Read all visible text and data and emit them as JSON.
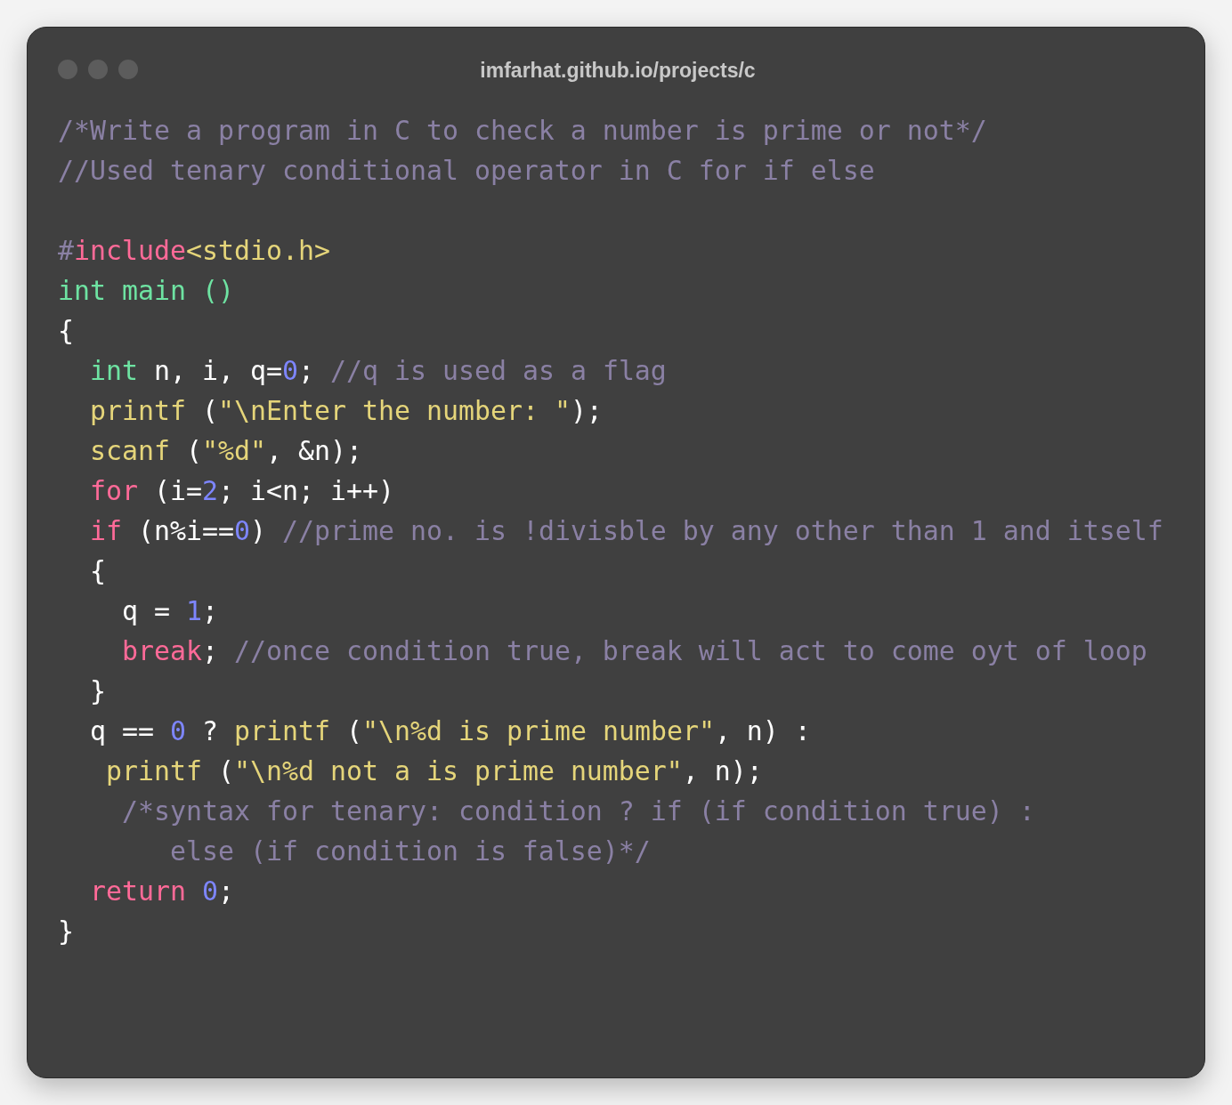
{
  "window": {
    "title": "imfarhat.github.io/projects/c"
  },
  "code_lines": [
    {
      "kind": "code",
      "tokens": [
        {
          "kind": "comment",
          "text": "/*Write a program in C to check a number is prime or not*/"
        }
      ]
    },
    {
      "kind": "code",
      "tokens": [
        {
          "kind": "comment",
          "text": "//Used tenary conditional operator in C for if else"
        }
      ]
    },
    {
      "kind": "blank"
    },
    {
      "kind": "code",
      "tokens": [
        {
          "kind": "comment",
          "text": "#"
        },
        {
          "kind": "keyword",
          "text": "include"
        },
        {
          "kind": "string",
          "text": "<stdio.h>"
        }
      ]
    },
    {
      "kind": "code",
      "tokens": [
        {
          "kind": "type",
          "text": "int main ()"
        }
      ]
    },
    {
      "kind": "code",
      "tokens": [
        {
          "kind": "plain",
          "text": "{"
        }
      ]
    },
    {
      "kind": "code",
      "tokens": [
        {
          "kind": "type",
          "text": "  int"
        },
        {
          "kind": "plain",
          "text": " n, i, q="
        },
        {
          "kind": "number",
          "text": "0"
        },
        {
          "kind": "plain",
          "text": "; "
        },
        {
          "kind": "comment",
          "text": "//q is used as a flag"
        }
      ]
    },
    {
      "kind": "code",
      "tokens": [
        {
          "kind": "string",
          "text": "  printf"
        },
        {
          "kind": "plain",
          "text": " ("
        },
        {
          "kind": "string",
          "text": "\"\\nEnter the number: \""
        },
        {
          "kind": "plain",
          "text": ");"
        }
      ]
    },
    {
      "kind": "code",
      "tokens": [
        {
          "kind": "string",
          "text": "  scanf"
        },
        {
          "kind": "plain",
          "text": " ("
        },
        {
          "kind": "string",
          "text": "\"%d\""
        },
        {
          "kind": "plain",
          "text": ", &n);"
        }
      ]
    },
    {
      "kind": "code",
      "tokens": [
        {
          "kind": "keyword",
          "text": "  for"
        },
        {
          "kind": "plain",
          "text": " (i="
        },
        {
          "kind": "number",
          "text": "2"
        },
        {
          "kind": "plain",
          "text": "; i<n; i++)"
        }
      ]
    },
    {
      "kind": "code",
      "tokens": [
        {
          "kind": "keyword",
          "text": "  if"
        },
        {
          "kind": "plain",
          "text": " (n%i=="
        },
        {
          "kind": "number",
          "text": "0"
        },
        {
          "kind": "plain",
          "text": ") "
        },
        {
          "kind": "comment",
          "text": "//prime no. is !divisble by any other than 1 and itself"
        }
      ]
    },
    {
      "kind": "code",
      "tokens": [
        {
          "kind": "plain",
          "text": "  {"
        }
      ]
    },
    {
      "kind": "code",
      "tokens": [
        {
          "kind": "plain",
          "text": "    q = "
        },
        {
          "kind": "number",
          "text": "1"
        },
        {
          "kind": "plain",
          "text": ";"
        }
      ]
    },
    {
      "kind": "code",
      "tokens": [
        {
          "kind": "keyword",
          "text": "    break"
        },
        {
          "kind": "plain",
          "text": "; "
        },
        {
          "kind": "comment",
          "text": "//once condition true, break will act to come oyt of loop"
        }
      ]
    },
    {
      "kind": "code",
      "tokens": [
        {
          "kind": "plain",
          "text": "  }"
        }
      ]
    },
    {
      "kind": "code",
      "tokens": [
        {
          "kind": "plain",
          "text": "  q == "
        },
        {
          "kind": "number",
          "text": "0"
        },
        {
          "kind": "plain",
          "text": " ? "
        },
        {
          "kind": "string",
          "text": "printf"
        },
        {
          "kind": "plain",
          "text": " ("
        },
        {
          "kind": "string",
          "text": "\"\\n%d is prime number\""
        },
        {
          "kind": "plain",
          "text": ", n) :"
        }
      ]
    },
    {
      "kind": "code",
      "tokens": [
        {
          "kind": "string",
          "text": "   printf"
        },
        {
          "kind": "plain",
          "text": " ("
        },
        {
          "kind": "string",
          "text": "\"\\n%d not a is prime number\""
        },
        {
          "kind": "plain",
          "text": ", n);"
        }
      ]
    },
    {
      "kind": "code",
      "tokens": [
        {
          "kind": "comment",
          "text": "    /*syntax for tenary: condition ? if (if condition true) :"
        }
      ]
    },
    {
      "kind": "code",
      "tokens": [
        {
          "kind": "comment",
          "text": "       else (if condition is false)*/"
        }
      ]
    },
    {
      "kind": "code",
      "tokens": [
        {
          "kind": "keyword",
          "text": "  return"
        },
        {
          "kind": "number",
          "text": " 0"
        },
        {
          "kind": "plain",
          "text": ";"
        }
      ]
    },
    {
      "kind": "code",
      "tokens": [
        {
          "kind": "plain",
          "text": "}"
        }
      ]
    }
  ]
}
